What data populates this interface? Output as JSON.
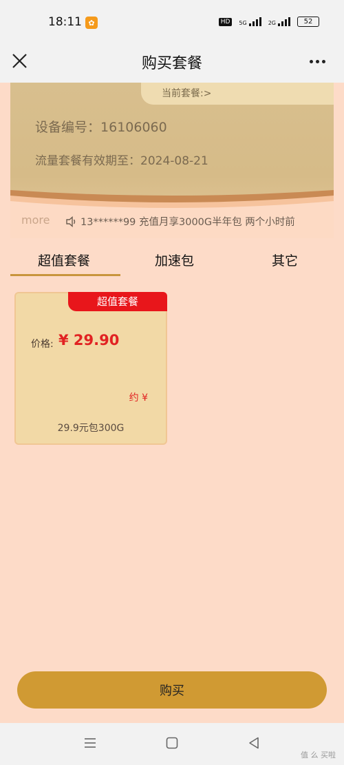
{
  "status_bar": {
    "time": "18:11",
    "hd": "HD",
    "signal1_label": "5G",
    "signal2_label": "2G",
    "battery": "52"
  },
  "header": {
    "title": "购买套餐"
  },
  "device_card": {
    "current_plan_label": "当前套餐:>",
    "device_label": "设备编号：",
    "device_number": "16106060",
    "valid_label": "流量套餐有效期至：",
    "valid_date": "2024-08-21",
    "more": "more",
    "announcement": "13******99 充值月享3000G半年包 两个小时前"
  },
  "tabs": [
    {
      "label": "超值套餐",
      "active": true
    },
    {
      "label": "加速包",
      "active": false
    },
    {
      "label": "其它",
      "active": false
    }
  ],
  "products": [
    {
      "tag": "超值套餐",
      "price_label": "价格:",
      "price": "¥ 29.90",
      "approx": "约 ¥",
      "description": "29.9元包300G"
    }
  ],
  "buy_button": {
    "label": "购买"
  },
  "watermark": "值 么 买啦",
  "colors": {
    "page_bg": "#fddbc8",
    "accent_gold": "#d09a33",
    "tag_red": "#e8161b",
    "price_red": "#e12222"
  }
}
